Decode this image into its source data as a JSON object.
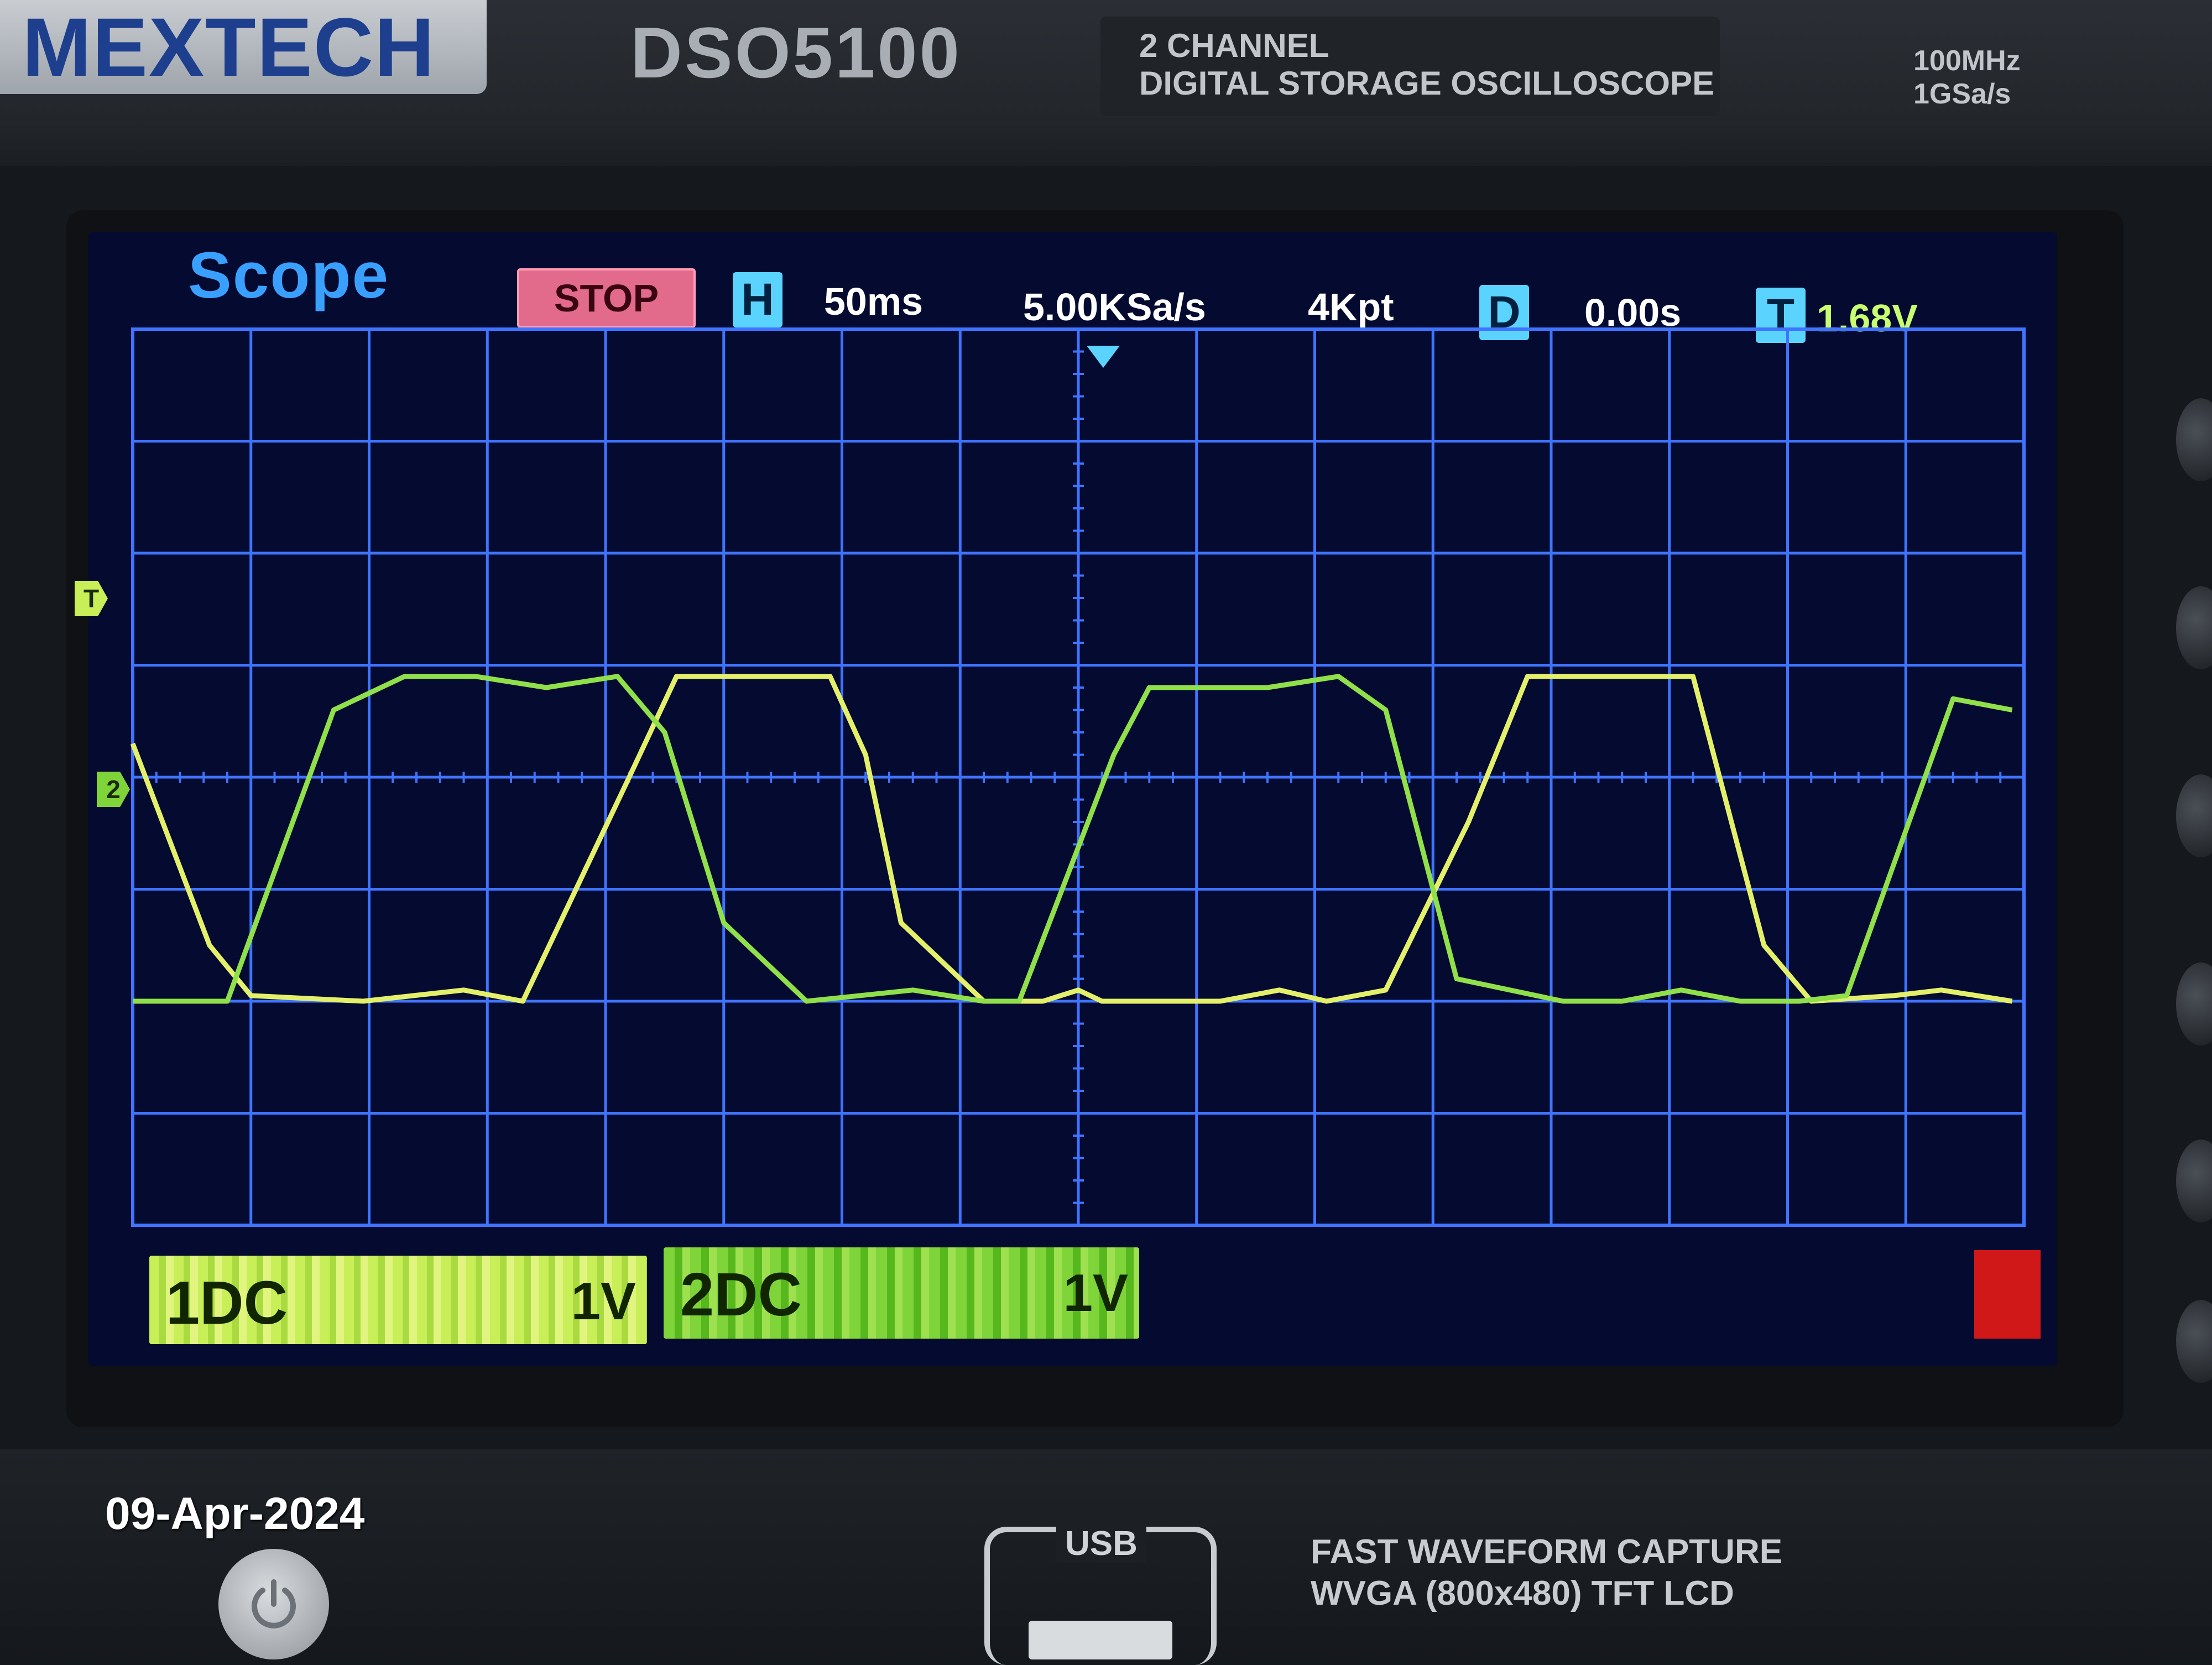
{
  "device": {
    "brand": "MEXTECH",
    "model": "DSO5100",
    "desc_line1": "2 CHANNEL",
    "desc_line2": "DIGITAL STORAGE OSCILLOSCOPE",
    "bandwidth": "100MHz",
    "sample_rate_max": "1GSa/s"
  },
  "screen": {
    "title": "Scope",
    "run_state": "STOP",
    "h_tag": "H",
    "timebase": "50ms",
    "sample_rate": "5.00KSa/s",
    "memory_depth": "4Kpt",
    "d_tag": "D",
    "delay": "0.00s",
    "t_tag": "T",
    "trigger_level": "1.68V",
    "trigger_marker": "T",
    "ch_marker": "2"
  },
  "channels": [
    {
      "name": "1DC",
      "volts_div": "1V",
      "color": "#d8ef60"
    },
    {
      "name": "2DC",
      "volts_div": "1V",
      "color": "#7fd43a"
    }
  ],
  "colors": {
    "grid": "#3e74ff",
    "lcd_bg": "#040a30",
    "ch1_trace": "#e4f06a",
    "ch2_trace": "#8fe04a",
    "stop_badge": "#e26a8a",
    "tag_box": "#5ad4ff"
  },
  "front_panel": {
    "date": "09-Apr-2024",
    "usb_label": "USB",
    "info_line1": "FAST WAVEFORM CAPTURE",
    "info_line2": "WVGA (800x480) TFT LCD"
  },
  "icons": {
    "power": "power-icon"
  },
  "chart_data": {
    "type": "line",
    "x_unit": "div",
    "y_unit": "div",
    "xlim": [
      0,
      16
    ],
    "ylim": [
      -2,
      6
    ],
    "series": [
      {
        "name": "1DC",
        "x": [
          0,
          0.65,
          1.0,
          1.95,
          2.8,
          3.3,
          4.2,
          4.6,
          5.4,
          5.9,
          6.2,
          6.5,
          7.2,
          7.7,
          8.0,
          8.2,
          9.2,
          9.7,
          10.1,
          10.6,
          11.3,
          11.8,
          12.2,
          12.7,
          13.2,
          13.8,
          14.2,
          14.9,
          15.3,
          15.9
        ],
        "y": [
          2.3,
          0.5,
          0.05,
          0.0,
          0.1,
          0.0,
          2.0,
          2.9,
          2.9,
          2.9,
          2.2,
          0.7,
          0.0,
          0.0,
          0.1,
          0.0,
          0.0,
          0.1,
          0.0,
          0.1,
          1.6,
          2.9,
          2.9,
          2.9,
          2.9,
          0.5,
          0.0,
          0.05,
          0.1,
          0.0
        ]
      },
      {
        "name": "2DC",
        "x": [
          0,
          0.8,
          1.7,
          2.3,
          2.9,
          3.5,
          4.1,
          4.5,
          5.0,
          5.7,
          6.6,
          7.2,
          7.5,
          8.3,
          8.6,
          9.6,
          10.2,
          10.6,
          11.2,
          12.1,
          12.6,
          13.1,
          13.6,
          14.1,
          14.5,
          15.4,
          15.9
        ],
        "y": [
          0.0,
          0.0,
          2.6,
          2.9,
          2.9,
          2.8,
          2.9,
          2.4,
          0.7,
          0.0,
          0.1,
          0.0,
          0.0,
          2.2,
          2.8,
          2.8,
          2.9,
          2.6,
          0.2,
          0.0,
          0.0,
          0.1,
          0.0,
          0.0,
          0.05,
          2.7,
          2.6
        ]
      }
    ]
  }
}
